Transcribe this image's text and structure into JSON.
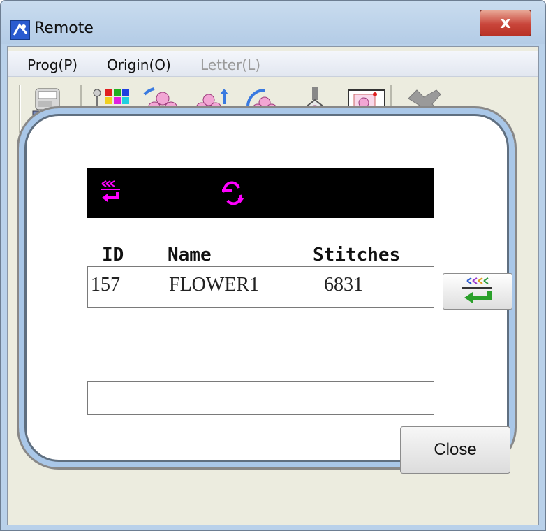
{
  "window": {
    "title": "Remote",
    "close_symbol": "x"
  },
  "menu": [
    {
      "label": "Prog(P)",
      "enabled": true
    },
    {
      "label": "Origin(O)",
      "enabled": true
    },
    {
      "label": "Letter(L)",
      "enabled": false
    }
  ],
  "toolbar": {
    "icons": [
      "machine-folder-icon",
      "color-palette-hand-icon",
      "rotate-design-icon",
      "move-design-icon",
      "center-design-icon",
      "hoop-trace-icon",
      "frame-origin-icon",
      "tools-icon"
    ]
  },
  "display": {
    "left_icon": "send-pattern-icon",
    "center_icon": "swap-icon",
    "accent_color": "#ff00ff"
  },
  "pattern_list": {
    "headers": {
      "id": "ID",
      "name": "Name",
      "stitches": "Stitches"
    },
    "rows": [
      {
        "id": "157",
        "name": "FLOWER1",
        "stitches": "6831"
      }
    ]
  },
  "buttons": {
    "close": "Close",
    "send_icon": "send-pattern-icon"
  }
}
